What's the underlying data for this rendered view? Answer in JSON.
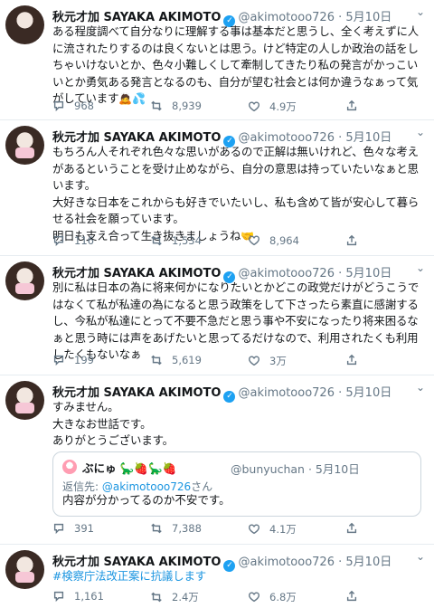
{
  "tweets": [
    {
      "name": "秋元才加 SAYAKA AKIMOTO",
      "handle": "@akimotooo726",
      "dot": "·",
      "date": "5月10日",
      "text": "ある程度調べて自分なりに理解する事は基本だと思うし、全く考えずに人に流されたりするのは良くないとは思う。けど特定の人しか政治の話をしちゃいけないとか、色々小難しくして牽制してきたり私の発言がかっこいいとか勇気ある発言となるのも、自分が望む社会とは何か違うなぁって気がしています",
      "emoji": "🙇💦",
      "replies": "968",
      "retweets": "8,939",
      "likes": "4.9万"
    },
    {
      "name": "秋元才加 SAYAKA AKIMOTO",
      "handle": "@akimotooo726",
      "dot": "·",
      "date": "5月10日",
      "text": "もちろん人それぞれ色々な思いがあるので正解は無いけれど、色々な考えがあるということを受け止めながら、自分の意思は持っていたいなぁと思います。\n大好きな日本をこれからも好きでいたいし、私も含めて皆が安心して暮らせる社会を願っています。\n明日も支え合って生き抜きましょうね",
      "emoji": "🤝",
      "replies": "116",
      "retweets": "1,534",
      "likes": "8,964"
    },
    {
      "name": "秋元才加 SAYAKA AKIMOTO",
      "handle": "@akimotooo726",
      "dot": "·",
      "date": "5月10日",
      "text": "別に私は日本の為に将来何かになりたいとかどこの政党だけがどうこうではなくて私が私達の為になると思う政策をして下さったら素直に感謝するし、今私が私達にとって不要不急だと思う事や不安になったり将来困るなぁと思う時には声をあげたいと思ってるだけなので、利用されたくも利用したくもないなぁ",
      "replies": "199",
      "retweets": "5,619",
      "likes": "3万"
    },
    {
      "name": "秋元才加 SAYAKA AKIMOTO",
      "handle": "@akimotooo726",
      "dot": "·",
      "date": "5月10日",
      "text": "すみません。\n大きなお世話です。\nありがとうございます。",
      "quote": {
        "name": "ぶにゅ 🦕🍓🦕🍓",
        "handle": "@bunyuchan · 5月10日",
        "reply_prefix": "返信先: ",
        "reply_mention": "@akimotooo726",
        "reply_suffix": "さん",
        "text": "内容が分かってるのか不安です。"
      },
      "replies": "391",
      "retweets": "7,388",
      "likes": "4.1万"
    },
    {
      "name": "秋元才加 SAYAKA AKIMOTO",
      "handle": "@akimotooo726",
      "dot": "·",
      "date": "5月10日",
      "text": "#検察庁法改正案に抗議します",
      "replies": "1,161",
      "retweets": "2.4万",
      "likes": "6.8万"
    }
  ],
  "colors": {
    "link": "#1b95e0",
    "verified": "#1da1f2",
    "muted": "#657786"
  },
  "icons": [
    "reply-icon",
    "retweet-icon",
    "like-icon",
    "share-icon",
    "chevron-down-icon",
    "verified-badge-icon"
  ]
}
